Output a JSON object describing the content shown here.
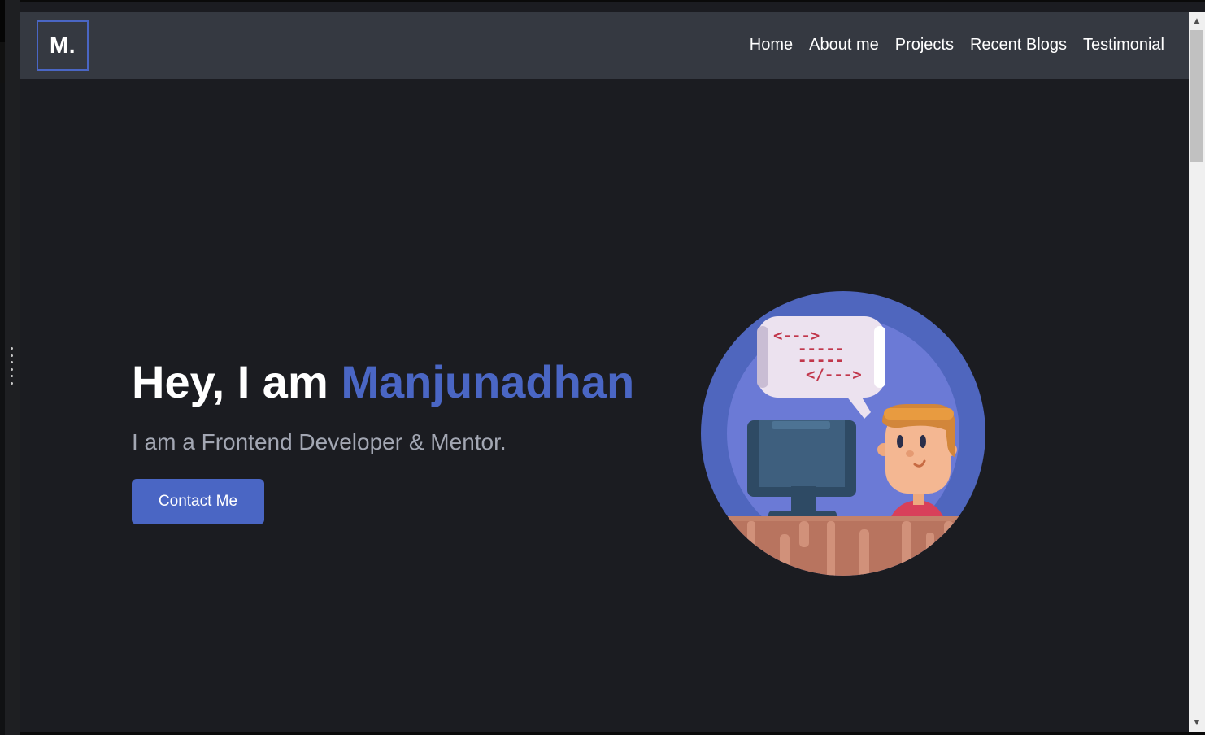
{
  "logo": {
    "text": "M."
  },
  "nav": {
    "items": [
      {
        "label": "Home"
      },
      {
        "label": "About me"
      },
      {
        "label": "Projects"
      },
      {
        "label": "Recent Blogs"
      },
      {
        "label": "Testimonial"
      }
    ]
  },
  "hero": {
    "greeting": "Hey, I am ",
    "name": "Manjunadhan",
    "subtitle": "I am a Frontend Developer & Mentor.",
    "cta_label": "Contact Me"
  },
  "illustration": {
    "bubble_lines": [
      "<--->",
      "-----",
      "-----",
      "</--->"
    ]
  },
  "colors": {
    "accent": "#4a66c4",
    "navbar_bg": "#353941",
    "page_bg": "#1b1c21",
    "subtitle": "#a3a7b3"
  },
  "icons": {
    "drag_handle": "vertical-dots-icon",
    "scroll_up": "triangle-up-icon",
    "scroll_down": "triangle-down-icon"
  }
}
